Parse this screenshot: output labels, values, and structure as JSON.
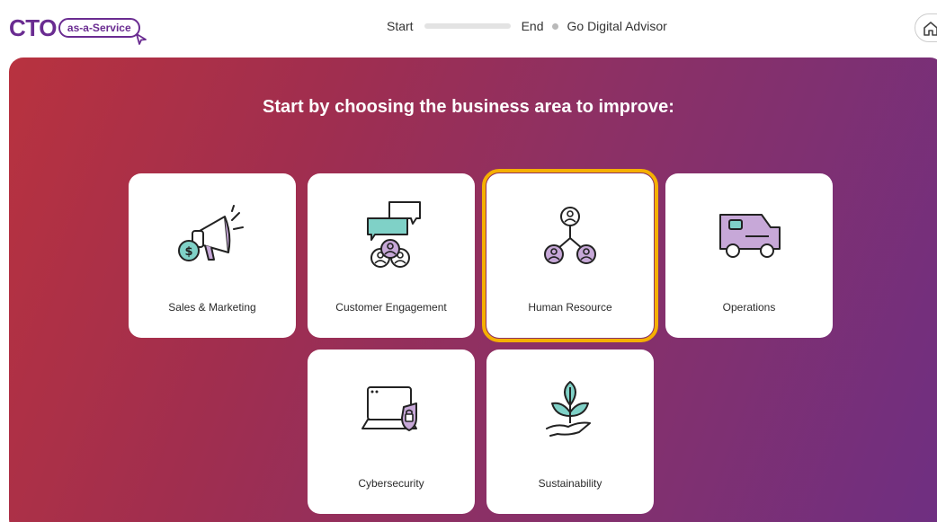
{
  "header": {
    "logo_main": "CTO",
    "logo_pill": "as-a-Service",
    "progress_start": "Start",
    "progress_end": "End",
    "advisor_link": "Go Digital Advisor"
  },
  "main": {
    "title": "Start by choosing the business area to improve:",
    "cards": [
      {
        "label": "Sales & Marketing",
        "icon": "megaphone-icon"
      },
      {
        "label": "Customer Engagement",
        "icon": "chat-people-icon"
      },
      {
        "label": "Human Resource",
        "icon": "org-people-icon",
        "selected": true
      },
      {
        "label": "Operations",
        "icon": "van-icon"
      },
      {
        "label": "Cybersecurity",
        "icon": "laptop-lock-icon"
      },
      {
        "label": "Sustainability",
        "icon": "plant-hand-icon"
      }
    ]
  },
  "colors": {
    "brand_purple": "#6a2c91",
    "selected_outline": "#f5b000",
    "icon_teal": "#7fd1c7",
    "icon_lilac": "#c7a8d8"
  }
}
